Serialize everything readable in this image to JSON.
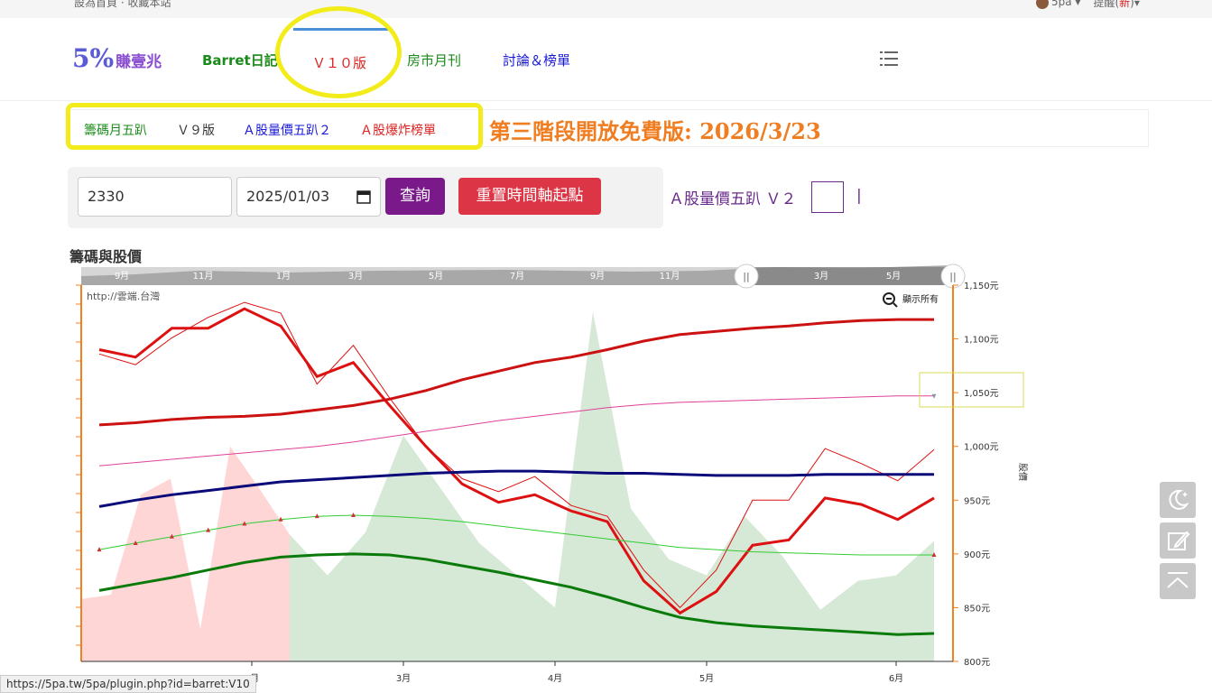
{
  "topbar": {
    "left_text": "設為首頁 · 收藏本站",
    "user": "5pa ▾",
    "reminder": "提醒(",
    "reminder_new": "新",
    "reminder_end": ")▾"
  },
  "nav": {
    "logo_pct": "5%",
    "logo_text": "賺壹兆",
    "items": [
      "Barret日記",
      "Ｖ１０版",
      "房市月刊",
      "討論＆榜單"
    ],
    "colors": {
      "barret": "#1a8a1a",
      "v10": "#dd2222",
      "fangshi": "#1a8a1a",
      "taolun": "#1a1ad6"
    }
  },
  "subnav": {
    "items": [
      "籌碼月五趴",
      "Ｖ９版",
      "Ａ股量價五趴２",
      "Ａ股爆炸榜單"
    ],
    "headline": "第三階段開放免費版: 2026/3/23"
  },
  "query": {
    "stock_value": "2330",
    "date_value": "2025/01/03",
    "query_label": "查詢",
    "reset_label": "重置時間軸起點",
    "v2_link": "Ａ股量價五趴 Ｖ２",
    "separator": "|"
  },
  "chart_section_title": "籌碼與股價",
  "navigator_labels": [
    "9月",
    "11月",
    "1月",
    "3月",
    "5月",
    "7月",
    "9月",
    "11月",
    "1月",
    "3月",
    "5月"
  ],
  "chart_watermark": "http://雲端.台灣",
  "show_all_label": "顯示所有",
  "status_url": "https://5pa.tw/5pa/plugin.php?id=barret:V10",
  "chart_data": {
    "type": "line",
    "x": [
      "2025-01-03",
      "2025-01-10",
      "2025-01-17",
      "2025-01-24",
      "2025-01-31",
      "2025-02-07",
      "2025-02-14",
      "2025-02-21",
      "2025-02-28",
      "2025-03-07",
      "2025-03-14",
      "2025-03-21",
      "2025-03-28",
      "2025-04-04",
      "2025-04-11",
      "2025-04-18",
      "2025-04-25",
      "2025-05-02",
      "2025-05-09",
      "2025-05-16",
      "2025-05-23",
      "2025-05-30",
      "2025-06-06",
      "2025-06-13"
    ],
    "x_ticks": [
      "2月",
      "3月",
      "4月",
      "5月",
      "6月"
    ],
    "y_ticks": [
      "1,150元",
      "1,100元",
      "1,050元",
      "1,000元",
      "950元",
      "900元",
      "850元",
      "800元"
    ],
    "ylim": [
      800,
      1150
    ],
    "ylabel": "股價",
    "series": [
      {
        "color": "#dd1111",
        "width": 3,
        "values": [
          1090,
          1083,
          1110,
          1110,
          1128,
          1112,
          1065,
          1078,
          1038,
          1000,
          965,
          948,
          955,
          940,
          930,
          875,
          845,
          865,
          908,
          913,
          952,
          946,
          932,
          952
        ]
      },
      {
        "color": "#dd1111",
        "width": 1,
        "values": [
          1086,
          1076,
          1101,
          1120,
          1134,
          1124,
          1058,
          1094,
          1045,
          1000,
          970,
          958,
          972,
          945,
          935,
          885,
          850,
          885,
          950,
          950,
          998,
          984,
          968,
          997
        ]
      },
      {
        "color": "#cc1111",
        "width": 3,
        "values": [
          1020,
          1022,
          1025,
          1027,
          1028,
          1030,
          1034,
          1038,
          1044,
          1052,
          1062,
          1070,
          1078,
          1083,
          1090,
          1098,
          1104,
          1107,
          1110,
          1112,
          1115,
          1117,
          1118,
          1118
        ]
      },
      {
        "color": "#e0409a",
        "width": 1,
        "values": [
          982,
          985,
          988,
          991,
          994,
          997,
          1000,
          1004,
          1009,
          1014,
          1019,
          1024,
          1028,
          1032,
          1036,
          1039,
          1041,
          1042,
          1043,
          1044,
          1045,
          1046,
          1047,
          1047
        ]
      },
      {
        "color": "#0a0a7a",
        "width": 3,
        "values": [
          944,
          950,
          955,
          959,
          963,
          967,
          969,
          971,
          973,
          975,
          976,
          977,
          977,
          976,
          975,
          975,
          974,
          973,
          973,
          973,
          974,
          974,
          974,
          974
        ]
      },
      {
        "color": "#33cc33",
        "width": 1,
        "values": [
          904,
          910,
          916,
          922,
          928,
          932,
          935,
          936,
          935,
          933,
          930,
          926,
          922,
          918,
          914,
          910,
          906,
          904,
          902,
          901,
          900,
          899,
          899,
          899
        ]
      },
      {
        "color": "#0a7a0a",
        "width": 3,
        "values": [
          866,
          872,
          878,
          885,
          892,
          897,
          899,
          900,
          899,
          895,
          889,
          883,
          876,
          869,
          860,
          850,
          841,
          836,
          833,
          831,
          829,
          827,
          825,
          826
        ]
      }
    ],
    "area_red_values": [
      858,
      862,
      955,
      970,
      830,
      1000,
      960,
      918
    ],
    "area_green_values": [
      918,
      880,
      920,
      1010,
      960,
      910,
      880,
      850,
      1125,
      942,
      895,
      880,
      935,
      898,
      848,
      875,
      880,
      912
    ]
  }
}
